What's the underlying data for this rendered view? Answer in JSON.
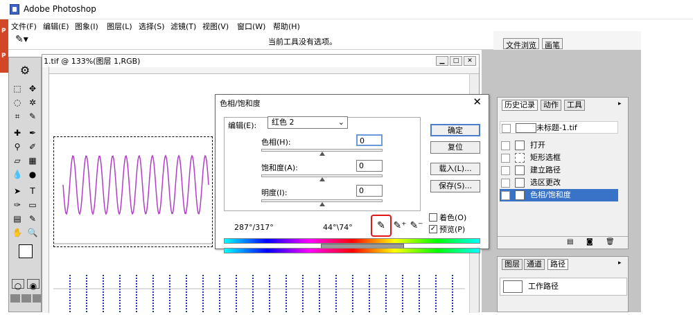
{
  "app": {
    "title": "Adobe Photoshop"
  },
  "taskbar": {
    "items": [
      "P",
      "P",
      "P"
    ]
  },
  "menu": [
    "文件(F)",
    "编辑(E)",
    "图象(I)",
    "图层(L)",
    "选择(S)",
    "滤镜(T)",
    "视图(V)",
    "窗口(W)",
    "帮助(H)"
  ],
  "options": {
    "message": "当前工具没有选项。"
  },
  "dock_tabs": [
    "文件浏览",
    "画笔"
  ],
  "document": {
    "title": "1.tif @ 133%(图层 1,RGB)"
  },
  "dialog": {
    "title": "色相/饱和度",
    "close": "✕",
    "edit_label": "编辑(E):",
    "edit_value": "红色 2",
    "hue_label": "色相(H):",
    "hue_value": "0",
    "sat_label": "饱和度(A):",
    "sat_value": "0",
    "light_label": "明度(I):",
    "light_value": "0",
    "buttons": {
      "ok": "确定",
      "reset": "复位",
      "load": "载入(L)...",
      "save": "保存(S)..."
    },
    "range_left": "287°/317°",
    "range_right": "44°\\74°",
    "colorize_label": "着色(O)",
    "preview_label": "预览(P)",
    "preview_checked": "✓"
  },
  "history": {
    "tabs": [
      "历史记录",
      "动作",
      "工具"
    ],
    "snapshot": "未标题-1.tif",
    "items": [
      "打开",
      "矩形选框",
      "建立路径",
      "选区更改",
      "色相/饱和度"
    ]
  },
  "layers": {
    "tabs": [
      "图层",
      "通道",
      "路径"
    ],
    "path_item": "工作路径"
  },
  "colors": {
    "accent": "#3873c8",
    "highlight": "#e21616",
    "purple_wave": "#b03cc8",
    "blue_wave": "#1a2fa8"
  }
}
